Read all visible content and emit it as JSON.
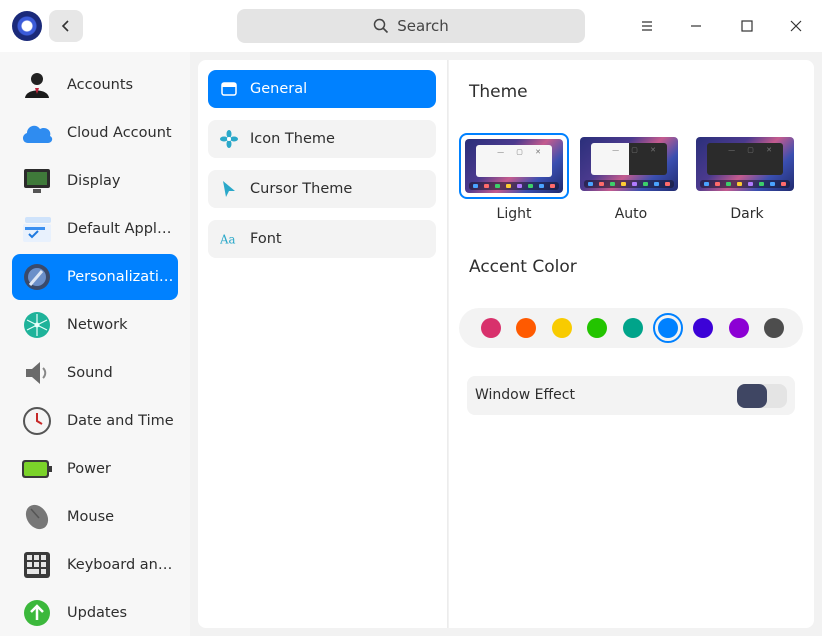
{
  "titlebar": {
    "search_placeholder": "Search"
  },
  "sidebar": {
    "items": [
      {
        "label": "Accounts",
        "icon": "accounts-icon"
      },
      {
        "label": "Cloud Account",
        "icon": "cloud-icon"
      },
      {
        "label": "Display",
        "icon": "display-icon"
      },
      {
        "label": "Default Applic...",
        "icon": "default-apps-icon"
      },
      {
        "label": "Personalization",
        "icon": "personalization-icon",
        "active": true
      },
      {
        "label": "Network",
        "icon": "network-icon"
      },
      {
        "label": "Sound",
        "icon": "sound-icon"
      },
      {
        "label": "Date and Time",
        "icon": "clock-icon"
      },
      {
        "label": "Power",
        "icon": "battery-icon"
      },
      {
        "label": "Mouse",
        "icon": "mouse-icon"
      },
      {
        "label": "Keyboard and ...",
        "icon": "keyboard-icon"
      },
      {
        "label": "Updates",
        "icon": "updates-icon"
      }
    ]
  },
  "submenu": {
    "items": [
      {
        "label": "General",
        "icon": "window-icon",
        "active": true
      },
      {
        "label": "Icon Theme",
        "icon": "flower-icon"
      },
      {
        "label": "Cursor Theme",
        "icon": "cursor-icon"
      },
      {
        "label": "Font",
        "icon": "font-icon"
      }
    ]
  },
  "theme": {
    "title": "Theme",
    "options": [
      {
        "label": "Light",
        "selected": true
      },
      {
        "label": "Auto"
      },
      {
        "label": "Dark"
      }
    ]
  },
  "accent": {
    "title": "Accent Color",
    "colors": [
      "#d8316c",
      "#ff5a00",
      "#f8cb00",
      "#23c400",
      "#00a48a",
      "#0081ff",
      "#3c02d7",
      "#8c00d4",
      "#4d4d4d"
    ],
    "selected": "#0081ff"
  },
  "window_effect": {
    "label": "Window Effect",
    "enabled": false
  },
  "colors": {
    "accent": "#0081ff"
  }
}
